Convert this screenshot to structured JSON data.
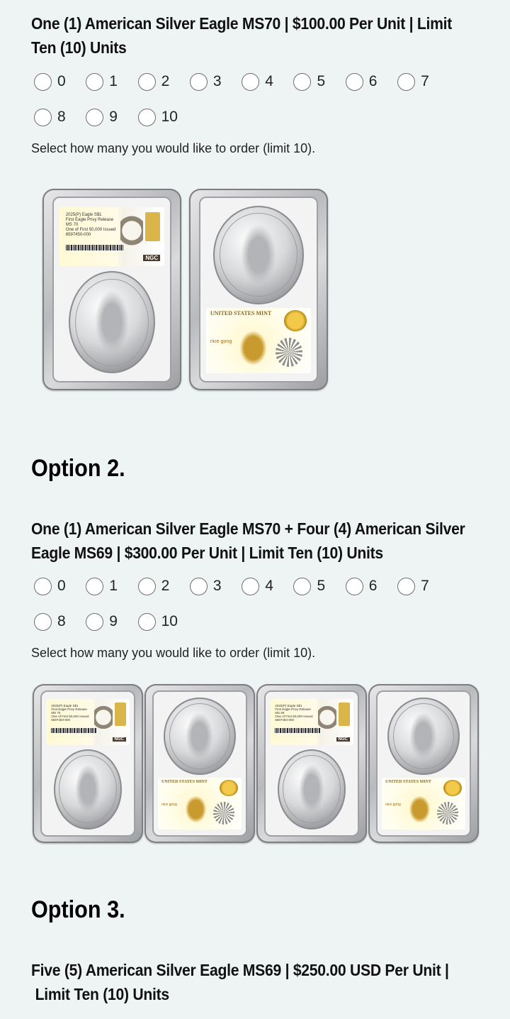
{
  "option1": {
    "title_line1": "One (1) American Silver Eagle MS70 | $100.00 Per Unit | Limit",
    "title_line2": "Ten (10) Units",
    "quantities": [
      "0",
      "1",
      "2",
      "3",
      "4",
      "5",
      "6",
      "7",
      "8",
      "9",
      "10"
    ],
    "hint": "Select how many you would like to order (limit 10)."
  },
  "option2": {
    "heading": "Option 2.",
    "title_line1": "One (1) American Silver Eagle MS70 + Four (4) American Silver",
    "title_line2": "Eagle MS69 | $300.00 Per Unit | Limit Ten (10) Units",
    "quantities": [
      "0",
      "1",
      "2",
      "3",
      "4",
      "5",
      "6",
      "7",
      "8",
      "9",
      "10"
    ],
    "hint": "Select how many you would like to order (limit 10)."
  },
  "option3": {
    "heading": "Option 3.",
    "title_line1": "Five (5) American Silver Eagle MS69 | $250.00 USD Per Unit |",
    "title_line2": " Limit Ten (10) Units"
  },
  "slab_labels": {
    "front_ms70": "2025(P) Eagle S$1\nFirst Eagle Privy Release\nMS 70\nOne of First 50,000 Issued\n6597450-000",
    "front_ms69": "2025(P) Eagle S$1\nFirst Eagle Privy Release\nMS 69\nOne of First 50,000 Issued\n6597450-000",
    "ngc": "NGC",
    "mint": "UNITED STATES MINT",
    "nice": "nice gong"
  }
}
